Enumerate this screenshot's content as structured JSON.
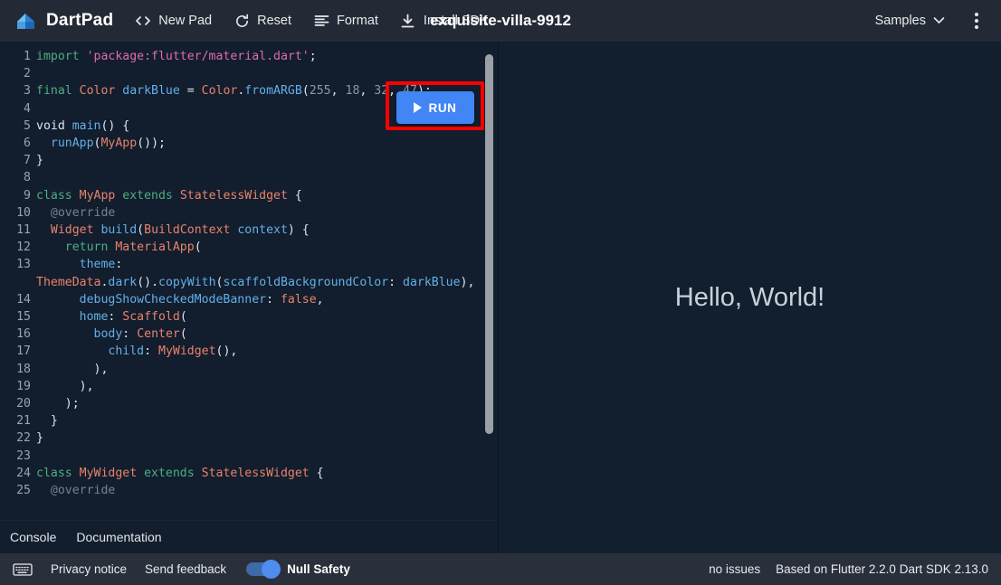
{
  "header": {
    "brand": "DartPad",
    "logo_icon": "dart-logo-icon",
    "doc_title": "exquisite-villa-9912",
    "tools": [
      {
        "label": "New Pad",
        "icon": "code-brackets-icon"
      },
      {
        "label": "Reset",
        "icon": "refresh-icon"
      },
      {
        "label": "Format",
        "icon": "format-lines-icon"
      },
      {
        "label": "Install SDK",
        "icon": "download-icon"
      }
    ],
    "samples_label": "Samples",
    "samples_chevron_icon": "chevron-down-icon",
    "more_icon": "kebab-menu-icon"
  },
  "run": {
    "label": "RUN",
    "play_icon": "play-icon",
    "highlight_color": "#ff0000",
    "button_color": "#4285f4"
  },
  "editor": {
    "lines": [
      {
        "n": "1",
        "tokens": [
          {
            "t": "import ",
            "c": "kw"
          },
          {
            "t": "'package:flutter/material.dart'",
            "c": "st"
          },
          {
            "t": ";",
            "c": "pn"
          }
        ]
      },
      {
        "n": "2",
        "tokens": []
      },
      {
        "n": "3",
        "tokens": [
          {
            "t": "final ",
            "c": "kw"
          },
          {
            "t": "Color ",
            "c": "ty"
          },
          {
            "t": "darkBlue",
            "c": "nm"
          },
          {
            "t": " = ",
            "c": "pn"
          },
          {
            "t": "Color",
            "c": "ty"
          },
          {
            "t": ".",
            "c": "pn"
          },
          {
            "t": "fromARGB",
            "c": "nm"
          },
          {
            "t": "(",
            "c": "pn"
          },
          {
            "t": "255",
            "c": "nu"
          },
          {
            "t": ", ",
            "c": "pn"
          },
          {
            "t": "18",
            "c": "nu"
          },
          {
            "t": ", ",
            "c": "pn"
          },
          {
            "t": "32",
            "c": "nu"
          },
          {
            "t": ", ",
            "c": "pn"
          },
          {
            "t": "47",
            "c": "nu"
          },
          {
            "t": ");",
            "c": "pn"
          }
        ]
      },
      {
        "n": "4",
        "tokens": []
      },
      {
        "n": "5",
        "tokens": [
          {
            "t": "void ",
            "c": "w"
          },
          {
            "t": "main",
            "c": "nm"
          },
          {
            "t": "() {",
            "c": "pn"
          }
        ]
      },
      {
        "n": "6",
        "tokens": [
          {
            "t": "  ",
            "c": "pn"
          },
          {
            "t": "runApp",
            "c": "nm"
          },
          {
            "t": "(",
            "c": "pn"
          },
          {
            "t": "MyApp",
            "c": "ty"
          },
          {
            "t": "());",
            "c": "pn"
          }
        ]
      },
      {
        "n": "7",
        "tokens": [
          {
            "t": "}",
            "c": "pn"
          }
        ]
      },
      {
        "n": "8",
        "tokens": []
      },
      {
        "n": "9",
        "tokens": [
          {
            "t": "class ",
            "c": "kw"
          },
          {
            "t": "MyApp ",
            "c": "ty"
          },
          {
            "t": "extends ",
            "c": "kw"
          },
          {
            "t": "StatelessWidget",
            "c": "ty"
          },
          {
            "t": " {",
            "c": "pn"
          }
        ]
      },
      {
        "n": "10",
        "tokens": [
          {
            "t": "  @override",
            "c": "cm"
          }
        ]
      },
      {
        "n": "11",
        "tokens": [
          {
            "t": "  ",
            "c": "pn"
          },
          {
            "t": "Widget ",
            "c": "ty"
          },
          {
            "t": "build",
            "c": "nm"
          },
          {
            "t": "(",
            "c": "pn"
          },
          {
            "t": "BuildContext ",
            "c": "ty"
          },
          {
            "t": "context",
            "c": "nm"
          },
          {
            "t": ") {",
            "c": "pn"
          }
        ]
      },
      {
        "n": "12",
        "tokens": [
          {
            "t": "    ",
            "c": "pn"
          },
          {
            "t": "return ",
            "c": "kw"
          },
          {
            "t": "MaterialApp",
            "c": "ty"
          },
          {
            "t": "(",
            "c": "pn"
          }
        ]
      },
      {
        "n": "13",
        "tokens": [
          {
            "t": "      ",
            "c": "pn"
          },
          {
            "t": "theme",
            "c": "nm"
          },
          {
            "t": ": ",
            "c": "pn"
          },
          {
            "t": "ThemeData",
            "c": "ty"
          },
          {
            "t": ".",
            "c": "pn"
          },
          {
            "t": "dark",
            "c": "nm"
          },
          {
            "t": "().",
            "c": "pn"
          },
          {
            "t": "copyWith",
            "c": "nm"
          },
          {
            "t": "(",
            "c": "pn"
          },
          {
            "t": "scaffoldBackgroundColor",
            "c": "nm"
          },
          {
            "t": ": ",
            "c": "pn"
          },
          {
            "t": "darkBlue",
            "c": "nm"
          },
          {
            "t": "),",
            "c": "pn"
          }
        ]
      },
      {
        "n": "14",
        "tokens": [
          {
            "t": "      ",
            "c": "pn"
          },
          {
            "t": "debugShowCheckedModeBanner",
            "c": "nm"
          },
          {
            "t": ": ",
            "c": "pn"
          },
          {
            "t": "false",
            "c": "ty"
          },
          {
            "t": ",",
            "c": "pn"
          }
        ]
      },
      {
        "n": "15",
        "tokens": [
          {
            "t": "      ",
            "c": "pn"
          },
          {
            "t": "home",
            "c": "nm"
          },
          {
            "t": ": ",
            "c": "pn"
          },
          {
            "t": "Scaffold",
            "c": "ty"
          },
          {
            "t": "(",
            "c": "pn"
          }
        ]
      },
      {
        "n": "16",
        "tokens": [
          {
            "t": "        ",
            "c": "pn"
          },
          {
            "t": "body",
            "c": "nm"
          },
          {
            "t": ": ",
            "c": "pn"
          },
          {
            "t": "Center",
            "c": "ty"
          },
          {
            "t": "(",
            "c": "pn"
          }
        ]
      },
      {
        "n": "17",
        "tokens": [
          {
            "t": "          ",
            "c": "pn"
          },
          {
            "t": "child",
            "c": "nm"
          },
          {
            "t": ": ",
            "c": "pn"
          },
          {
            "t": "MyWidget",
            "c": "ty"
          },
          {
            "t": "(),",
            "c": "pn"
          }
        ]
      },
      {
        "n": "18",
        "tokens": [
          {
            "t": "        ),",
            "c": "pn"
          }
        ]
      },
      {
        "n": "19",
        "tokens": [
          {
            "t": "      ),",
            "c": "pn"
          }
        ]
      },
      {
        "n": "20",
        "tokens": [
          {
            "t": "    );",
            "c": "pn"
          }
        ]
      },
      {
        "n": "21",
        "tokens": [
          {
            "t": "  }",
            "c": "pn"
          }
        ]
      },
      {
        "n": "22",
        "tokens": [
          {
            "t": "}",
            "c": "pn"
          }
        ]
      },
      {
        "n": "23",
        "tokens": []
      },
      {
        "n": "24",
        "tokens": [
          {
            "t": "class ",
            "c": "kw"
          },
          {
            "t": "MyWidget ",
            "c": "ty"
          },
          {
            "t": "extends ",
            "c": "kw"
          },
          {
            "t": "StatelessWidget",
            "c": "ty"
          },
          {
            "t": " {",
            "c": "pn"
          }
        ]
      },
      {
        "n": "25",
        "tokens": [
          {
            "t": "  @override",
            "c": "cm"
          }
        ]
      }
    ]
  },
  "panel_tabs": [
    {
      "label": "Console"
    },
    {
      "label": "Documentation"
    }
  ],
  "preview": {
    "text": "Hello, World!"
  },
  "footer": {
    "keyboard_icon": "keyboard-icon",
    "privacy_label": "Privacy notice",
    "feedback_label": "Send feedback",
    "null_safety_label": "Null Safety",
    "null_safety_on": true,
    "issues": "no issues",
    "version": "Based on Flutter 2.2.0 Dart SDK 2.13.0"
  }
}
